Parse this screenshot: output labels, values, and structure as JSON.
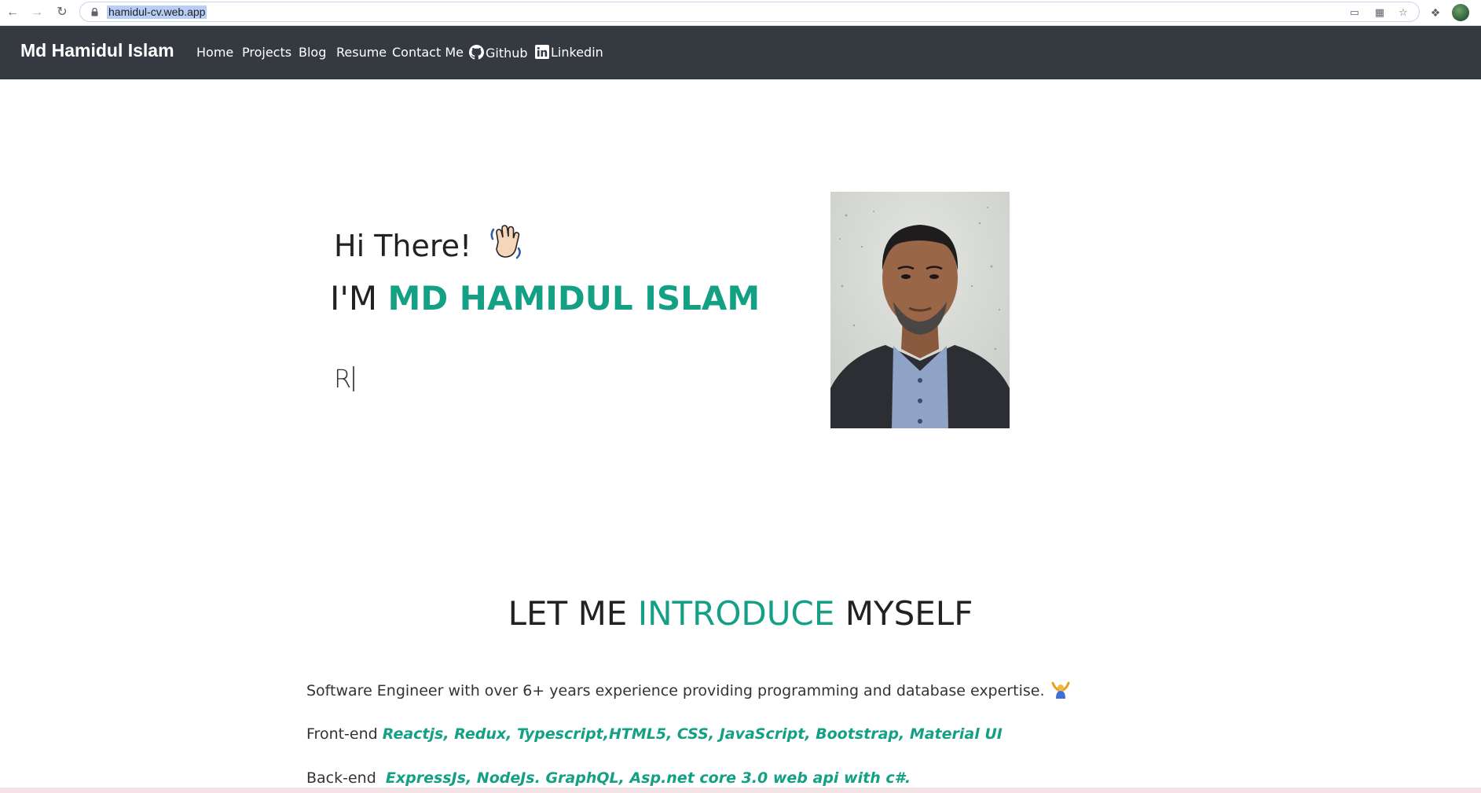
{
  "browser": {
    "url": "hamidul-cv.web.app"
  },
  "navbar": {
    "brand": "Md Hamidul Islam",
    "links": [
      {
        "label": "Home"
      },
      {
        "label": "Projects"
      },
      {
        "label": "Blog"
      },
      {
        "label": "Resume"
      },
      {
        "label": "Contact Me"
      },
      {
        "label": "Github",
        "icon": "github-icon"
      },
      {
        "label": "Linkedin",
        "icon": "linkedin-icon"
      }
    ]
  },
  "hero": {
    "greeting": "Hi There!",
    "greeting_emoji": "waving-hand-icon",
    "im_prefix": "I'M",
    "name": "MD HAMIDUL ISLAM",
    "typed_text": "R"
  },
  "intro": {
    "title_part1": "LET ME",
    "title_accent": "INTRODUCE",
    "title_part2": "MYSELF",
    "summary": "Software Engineer with over 6+ years experience providing programming and database expertise.",
    "frontend_label": "Front-end",
    "frontend_skills": "Reactjs, Redux, Typescript,HTML5, CSS, JavaScript, Bootstrap, Material UI",
    "backend_label": "Back-end",
    "backend_skills": "ExpressJs, NodeJs. GraphQL, Asp.net core 3.0 web api with c#."
  },
  "colors": {
    "accent": "#14a085",
    "navbar_bg": "#343a40"
  }
}
